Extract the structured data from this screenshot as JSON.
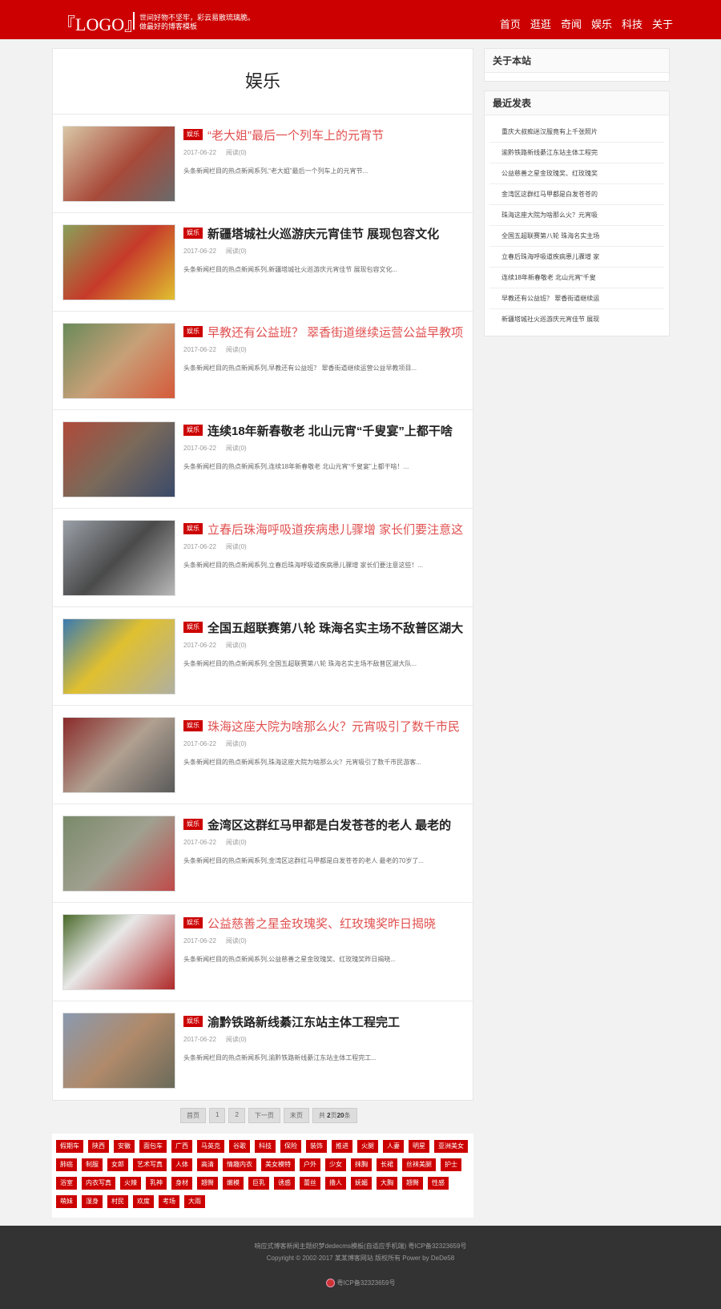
{
  "header": {
    "logo": "『LOGO』",
    "slogan_line1": "世间好物不坚牢，彩云易散琉璃脆。",
    "slogan_line2": "做最好的博客模板",
    "nav": [
      "首页",
      "逛逛",
      "奇闻",
      "娱乐",
      "科技",
      "关于"
    ]
  },
  "category_title": "娱乐",
  "articles": [
    {
      "tag": "娱乐",
      "title": "“老大姐”最后一个列车上的元宵节",
      "date": "2017-06-22",
      "reads": "阅读(0)",
      "desc": "头条新闻栏目的热点新闻系列,“老大姐”最后一个列车上的元宵节..."
    },
    {
      "tag": "娱乐",
      "title": "新疆塔城社火巡游庆元宵佳节 展现包容文化",
      "date": "2017-06-22",
      "reads": "阅读(0)",
      "desc": "头条新闻栏目的热点新闻系列,新疆塔城社火巡游庆元宵佳节 展现包容文化..."
    },
    {
      "tag": "娱乐",
      "title": "早教还有公益班？ 翠香街道继续运营公益早教项",
      "date": "2017-06-22",
      "reads": "阅读(0)",
      "desc": "头条新闻栏目的热点新闻系列,早教还有公益班？ 翠香街道继续运营公益早教项目..."
    },
    {
      "tag": "娱乐",
      "title": "连续18年新春敬老 北山元宵“千叟宴”上都干啥",
      "date": "2017-06-22",
      "reads": "阅读(0)",
      "desc": "头条新闻栏目的热点新闻系列,连续18年新春敬老 北山元宵“千叟宴”上都干啥！..."
    },
    {
      "tag": "娱乐",
      "title": "立春后珠海呼吸道疾病患儿骤增 家长们要注意这",
      "date": "2017-06-22",
      "reads": "阅读(0)",
      "desc": "头条新闻栏目的热点新闻系列,立春后珠海呼吸道疾病患儿骤增 家长们要注意这些！..."
    },
    {
      "tag": "娱乐",
      "title": "全国五超联赛第八轮 珠海名实主场不敌普区湖大",
      "date": "2017-06-22",
      "reads": "阅读(0)",
      "desc": "头条新闻栏目的热点新闻系列,全国五超联赛第八轮 珠海名实主场不敌普区湖大队..."
    },
    {
      "tag": "娱乐",
      "title": "珠海这座大院为啥那么火？元宵吸引了数千市民",
      "date": "2017-06-22",
      "reads": "阅读(0)",
      "desc": "头条新闻栏目的热点新闻系列,珠海这座大院为啥那么火？元宵吸引了数千市民游客..."
    },
    {
      "tag": "娱乐",
      "title": "金湾区这群红马甲都是白发苍苍的老人 最老的",
      "date": "2017-06-22",
      "reads": "阅读(0)",
      "desc": "头条新闻栏目的热点新闻系列,金湾区这群红马甲都是白发苍苍的老人 最老的70岁了..."
    },
    {
      "tag": "娱乐",
      "title": "公益慈善之星金玫瑰奖、红玫瑰奖昨日揭晓",
      "date": "2017-06-22",
      "reads": "阅读(0)",
      "desc": "头条新闻栏目的热点新闻系列,公益慈善之星金玫瑰奖、红玫瑰奖昨日揭晓..."
    },
    {
      "tag": "娱乐",
      "title": "渝黔铁路新线綦江东站主体工程完工",
      "date": "2017-06-22",
      "reads": "阅读(0)",
      "desc": "头条新闻栏目的热点新闻系列,渝黔铁路新线綦江东站主体工程完工..."
    }
  ],
  "pagination": {
    "first": "首页",
    "pages": [
      "1",
      "2"
    ],
    "next": "下一页",
    "last": "末页",
    "total_prefix": "共",
    "total_pages": "2",
    "total_pages_unit": "页",
    "total_items": "20",
    "total_items_unit": "条"
  },
  "tags": [
    "假期车",
    "陕西",
    "安徽",
    "面包车",
    "广西",
    "马英克",
    "谷歌",
    "科技",
    "保险",
    "装饰",
    "推进",
    "火腿",
    "人妻",
    "明星",
    "亚洲美女",
    "肺癌",
    "制服",
    "女郎",
    "艺术写真",
    "人体",
    "高清",
    "情趣内衣",
    "美女模特",
    "户外",
    "少女",
    "抹胸",
    "长裙",
    "丝袜美腿",
    "护士",
    "浴室",
    "内衣写真",
    "火辣",
    "乳神",
    "身材",
    "翘臀",
    "嫩模",
    "巨乳",
    "诱惑",
    "蕾丝",
    "撸人",
    "妩媚",
    "大胸",
    "翘臀",
    "性感",
    "萌妹",
    "湿身",
    "村民",
    "欢度",
    "考场",
    "大雨"
  ],
  "sidebar": {
    "about_title": "关于本站",
    "recent_title": "最近发表",
    "recent": [
      "重庆大叔痴迷汉服竟有上千张照片",
      "渝黔铁路新线綦江东站主体工程完",
      "公益慈善之星金玫瑰奖、红玫瑰奖",
      "金湾区这群红马甲都是白发苍苍的",
      "珠海这座大院为啥那么火？元宵吸",
      "全国五超联赛第八轮 珠海名实主场",
      "立春后珠海呼吸道疾病患儿骤增 家",
      "连续18年新春敬老 北山元宵“千叟",
      "早教还有公益班？ 翠香街道继续运",
      "新疆塔城社火巡游庆元宵佳节 展现"
    ]
  },
  "footer": {
    "line1": "响应式博客新闻主题织梦dedecms模板(自适应手机端) 粤ICP备32323659号",
    "line2": "Copyright © 2002-2017 某某博客网站 版权所有 Power by DeDe58",
    "icp": "粤ICP备32323659号"
  },
  "colors": {
    "brand": "#cc0000",
    "title_red": "#e15050",
    "footer_bg": "#333333"
  }
}
